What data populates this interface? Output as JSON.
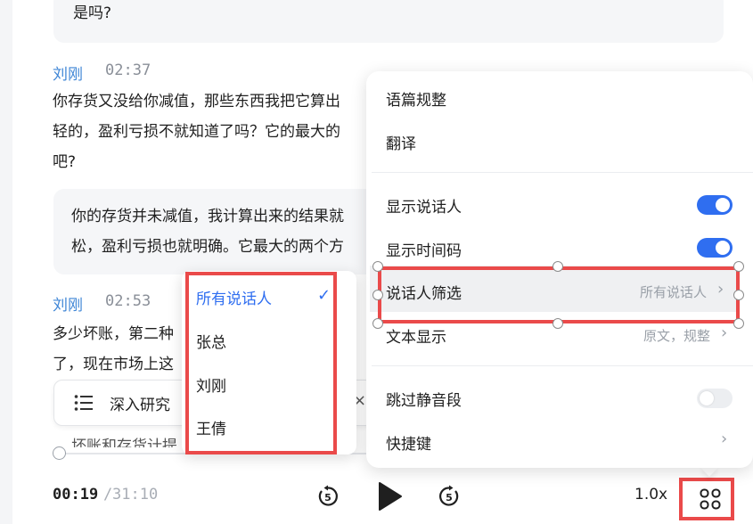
{
  "transcript": {
    "bubble_top_line": "是吗?",
    "seg1": {
      "speaker": "刘刚",
      "time": "02:37",
      "lines": [
        "你存货又没给你减值，那些东西我把它算出",
        "轻的，盈利亏损不就知道了吗？它的最大的",
        "吧?"
      ]
    },
    "bubble_mid_lines": [
      "你的存货并未减值，我计算出来的结果就",
      "松，盈利亏损也就明确。它最大的两个方"
    ],
    "seg2": {
      "speaker": "刘刚",
      "time": "02:53",
      "lines": [
        "多少坏账，第二种",
        "了，现在市场上这"
      ]
    },
    "research_label": "深入研究",
    "cut_line": "坏账和存货计提"
  },
  "player": {
    "current": "00:19",
    "separator": "/",
    "total": "31:10",
    "speed": "1.0x",
    "rewind_seconds": "5",
    "forward_seconds": "5"
  },
  "menu": {
    "items": {
      "normalize": "语篇规整",
      "translate": "翻译",
      "show_speaker": "显示说话人",
      "show_time": "显示时间码",
      "speaker_filter": "说话人筛选",
      "speaker_filter_value": "所有说话人",
      "text_display": "文本显示",
      "text_display_value": "原文，规整",
      "skip_silence": "跳过静音段",
      "shortcuts": "快捷键"
    },
    "toggles": {
      "show_speaker": true,
      "show_time": true,
      "skip_silence": false
    }
  },
  "speaker_dropdown": {
    "options": [
      "所有说话人",
      "张总",
      "刘刚",
      "王倩"
    ],
    "selected": "所有说话人"
  },
  "colors": {
    "accent": "#2f6ef0",
    "speaker_name": "#3f86d6",
    "highlight_frame": "#ea4a4a"
  }
}
